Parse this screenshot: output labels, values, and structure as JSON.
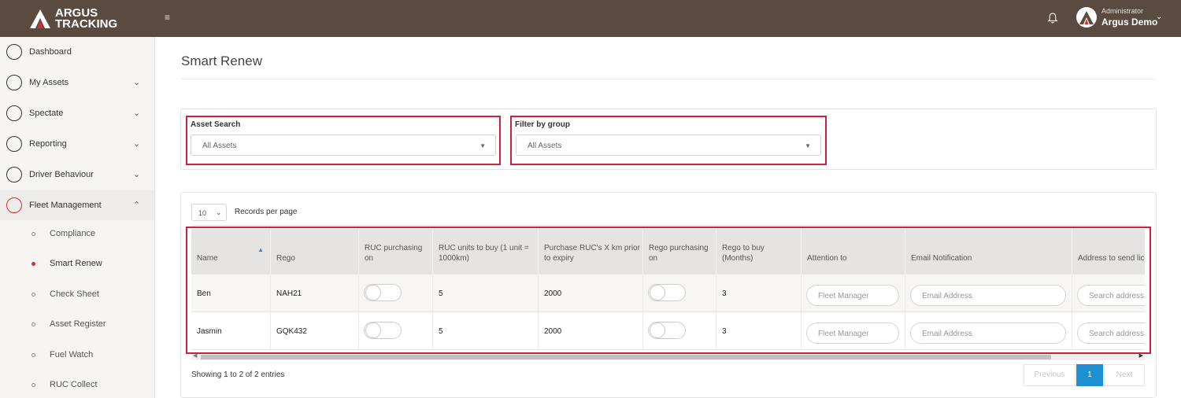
{
  "header": {
    "logo_line1": "ARGUS",
    "logo_line2": "TRACKING",
    "user_role": "Administrator",
    "user_name": "Argus Demo",
    "bar_color": "#5a4a40"
  },
  "sidebar": {
    "items": [
      {
        "label": "Dashboard",
        "icon": "speedometer-icon"
      },
      {
        "label": "My Assets",
        "icon": "assets-icon"
      },
      {
        "label": "Spectate",
        "icon": "location-pin-icon"
      },
      {
        "label": "Reporting",
        "icon": "report-icon"
      },
      {
        "label": "Driver Behaviour",
        "icon": "lightbulb-icon"
      },
      {
        "label": "Fleet Management",
        "icon": "car-icon"
      }
    ],
    "sub_items": [
      {
        "label": "Compliance"
      },
      {
        "label": "Smart Renew"
      },
      {
        "label": "Check Sheet"
      },
      {
        "label": "Asset Register"
      },
      {
        "label": "Fuel Watch"
      },
      {
        "label": "RUC Collect"
      }
    ],
    "active_sub": "Smart Renew",
    "accent": "#d32f2f"
  },
  "page": {
    "title": "Smart Renew"
  },
  "filters": {
    "asset_search_label": "Asset Search",
    "asset_search_value": "All Assets",
    "group_label": "Filter by group",
    "group_value": "All Assets",
    "highlight_color": "#d0213a"
  },
  "table": {
    "length_value": "10",
    "length_label": "Records per page",
    "columns": [
      "Name",
      "Rego",
      "RUC purchasing on",
      "RUC units to buy (1 unit = 1000km)",
      "Purchase RUC's X km prior to expiry",
      "Rego purchasing on",
      "Rego to buy (Months)",
      "Attention to",
      "Email Notification",
      "Address to send lic"
    ],
    "rows": [
      {
        "name": "Ben",
        "rego": "NAH21",
        "ruc_units": "5",
        "ruc_prior": "2000",
        "rego_months": "3"
      },
      {
        "name": "Jasmin",
        "rego": "GQK432",
        "ruc_units": "5",
        "ruc_prior": "2000",
        "rego_months": "3"
      }
    ],
    "placeholders": {
      "attention": "Fleet Manager",
      "email": "Email Address",
      "address": "Search address,"
    },
    "info": "Showing 1 to 2 of 2 entries",
    "pager": {
      "previous": "Previous",
      "current": "1",
      "next": "Next"
    },
    "pager_color": "#1e8fd0"
  }
}
